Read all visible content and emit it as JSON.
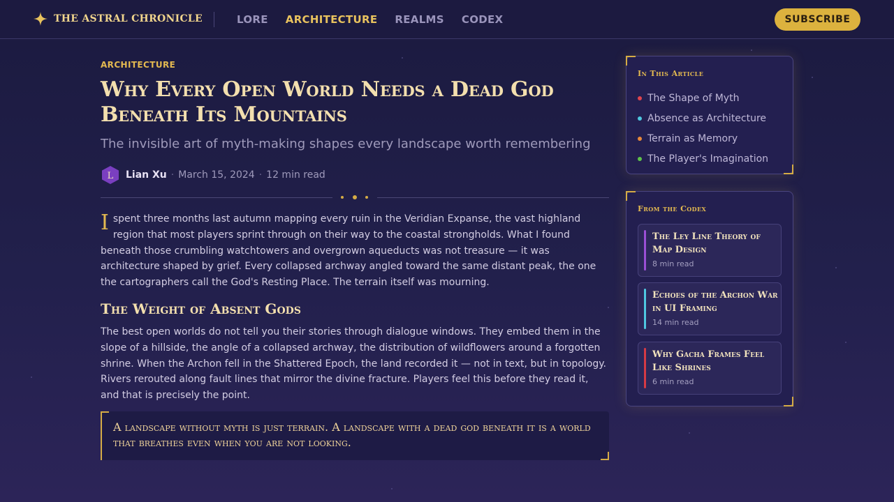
{
  "brand": {
    "name": "THE ASTRAL CHRONICLE",
    "icon": "four-point-star-icon",
    "accent_color": "#e8c25e"
  },
  "nav": {
    "items": [
      {
        "label": "LORE",
        "active": false
      },
      {
        "label": "ARCHITECTURE",
        "active": true
      },
      {
        "label": "REALMS",
        "active": false
      },
      {
        "label": "CODEX",
        "active": false
      }
    ],
    "subscribe_label": "SUBSCRIBE"
  },
  "article": {
    "kicker": "ARCHITECTURE",
    "title": "Why Every Open World Needs a Dead God Beneath Its Mountains",
    "subtitle": "The invisible art of myth-making shapes every landscape worth remembering",
    "author": {
      "initial": "L",
      "name": "Lian Xu"
    },
    "date": "March 15, 2024",
    "read_time": "12 min read",
    "paragraph1": {
      "dropcap": "I",
      "text": "spent three months last autumn mapping every ruin in the Veridian Expanse, the vast highland region that most players sprint through on their way to the coastal strongholds. What I found beneath those crumbling watchtowers and overgrown aqueducts was not treasure — it was architecture shaped by grief. Every collapsed archway angled toward the same distant peak, the one the cartographers call the God's Resting Place. The terrain itself was mourning."
    },
    "section_heading": "The Weight of Absent Gods",
    "paragraph2": "The best open worlds do not tell you their stories through dialogue windows. They embed them in the slope of a hillside, the angle of a collapsed archway, the distribution of wildflowers around a forgotten shrine. When the Archon fell in the Shattered Epoch, the land recorded it — not in text, but in topology. Rivers rerouted along fault lines that mirror the divine fracture. Players feel this before they read it, and that is precisely the point.",
    "pull_quote": "A landscape without myth is just terrain. A landscape with a dead god beneath it is a world that breathes even when you are not looking."
  },
  "toc": {
    "title": "In This Article",
    "items": [
      {
        "label": "The Shape of Myth",
        "color": "#e0454d"
      },
      {
        "label": "Absence as Architecture",
        "color": "#4fc7e0"
      },
      {
        "label": "Terrain as Memory",
        "color": "#e8893a"
      },
      {
        "label": "The Player's Imagination",
        "color": "#5fc24a"
      }
    ]
  },
  "codex": {
    "title": "From the Codex",
    "items": [
      {
        "title": "The Ley Line Theory of Map Design",
        "meta": "8 min read",
        "color": "#9b4fd6"
      },
      {
        "title": "Echoes of the Archon War in UI Framing",
        "meta": "14 min read",
        "color": "#4fc7e0"
      },
      {
        "title": "Why Gacha Frames Feel Like Shrines",
        "meta": "6 min read",
        "color": "#d63a45"
      }
    ]
  }
}
